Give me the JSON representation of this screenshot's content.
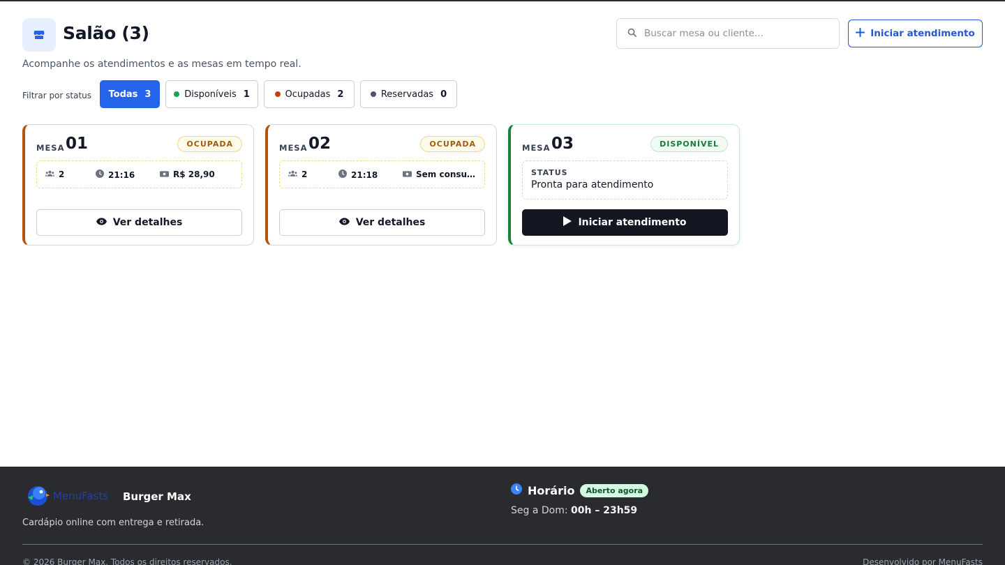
{
  "header": {
    "title": "Salão (3)",
    "subtitle": "Acompanhe os atendimentos e as mesas em tempo real.",
    "search_placeholder": "Buscar mesa ou cliente...",
    "start_button": "Iniciar atendimento",
    "icon": "store-icon"
  },
  "filters": {
    "label": "Filtrar por status",
    "items": [
      {
        "label": "Todas",
        "count": "3",
        "active": true
      },
      {
        "label": "Disponíveis",
        "count": "1",
        "color": "#16a34a"
      },
      {
        "label": "Ocupadas",
        "count": "2",
        "color": "#c2410c"
      },
      {
        "label": "Reservadas",
        "count": "0",
        "color": "#4b5563"
      }
    ]
  },
  "tables": [
    {
      "mesa_label": "MESA",
      "number": "01",
      "status": "OCUPADA",
      "people": "2",
      "time": "21:16",
      "amount": "R$ 28,90",
      "button": "Ver detalhes"
    },
    {
      "mesa_label": "MESA",
      "number": "02",
      "status": "OCUPADA",
      "people": "2",
      "time": "21:18",
      "amount": "Sem consu…",
      "button": "Ver detalhes"
    },
    {
      "mesa_label": "MESA",
      "number": "03",
      "status": "DISPONÍVEL",
      "status_label": "STATUS",
      "status_text": "Pronta para atendimento",
      "button": "Iniciar atendimento"
    }
  ],
  "colors": {
    "accent": "#2563eb",
    "occupied": "#b45309",
    "available": "#16803c",
    "footer_bg": "#2a2b2e"
  },
  "footer": {
    "logo_text": "MenuFasts",
    "brand": "Burger Max",
    "description": "Cardápio online com entrega e retirada.",
    "hours_title": "Horário",
    "open_badge": "Aberto agora",
    "hours_prefix": "Seg a Dom:",
    "hours_value": "00h – 23h59",
    "copyright": "© 2026 Burger Max. Todos os direitos reservados.",
    "developed_by": "Desenvolvido por MenuFasts"
  }
}
